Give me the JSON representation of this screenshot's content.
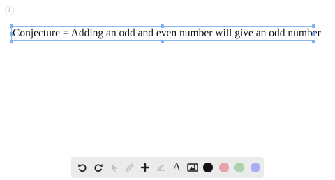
{
  "page": {
    "indicator_label": "1"
  },
  "text_box": {
    "content": "Conjecture = Adding an odd and even number will give an odd number"
  },
  "toolbar": {
    "tools": [
      {
        "name": "undo-icon"
      },
      {
        "name": "redo-icon"
      },
      {
        "name": "select-arrow-icon"
      },
      {
        "name": "pencil-icon"
      },
      {
        "name": "add-icon"
      },
      {
        "name": "eraser-icon"
      },
      {
        "name": "text-icon",
        "label": "A"
      },
      {
        "name": "image-icon"
      }
    ],
    "colors": [
      {
        "name": "color-black",
        "value": "#111111"
      },
      {
        "name": "color-red",
        "value": "#e8a3aa"
      },
      {
        "name": "color-green",
        "value": "#a9d3ab"
      },
      {
        "name": "color-blue",
        "value": "#a9aef0"
      }
    ]
  }
}
